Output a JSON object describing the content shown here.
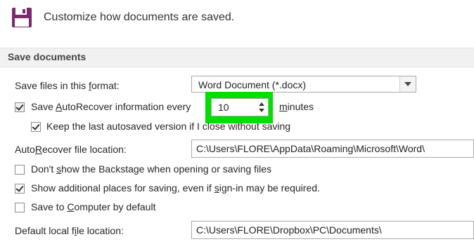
{
  "header": {
    "title": "Customize how documents are saved.",
    "icon": "floppy-disk-icon"
  },
  "section": {
    "title": "Save documents"
  },
  "format": {
    "label_pre": "Save files in this ",
    "label_key": "f",
    "label_post": "ormat:",
    "selected": "Word Document (*.docx)"
  },
  "autorecover": {
    "checked": true,
    "label_pre": "Save ",
    "label_key": "A",
    "label_post": "utoRecover information every",
    "minutes_value": "10",
    "minutes_key": "m",
    "minutes_rest": "inutes"
  },
  "keep_last": {
    "checked": true,
    "label": "Keep the last autosaved version if I close without saving"
  },
  "autorecover_location": {
    "label_pre": "Auto",
    "label_key": "R",
    "label_post": "ecover file location:",
    "value": "C:\\Users\\FLORE\\AppData\\Roaming\\Microsoft\\Word\\"
  },
  "backstage": {
    "checked": false,
    "label_pre": "Don't ",
    "label_key": "s",
    "label_post": "how the Backstage when opening or saving files"
  },
  "additional_places": {
    "checked": true,
    "label_pre": "Show additional places for saving, even if ",
    "label_key": "s",
    "label_post": "ign-in may be required."
  },
  "save_computer": {
    "checked": false,
    "label_pre": "Save to ",
    "label_key": "C",
    "label_post": "omputer by default"
  },
  "default_location": {
    "label_pre": "Default local f",
    "label_key": "i",
    "label_post": "le location:",
    "value": "C:\\Users\\FLORE\\Dropbox\\PC\\Documents\\"
  },
  "colors": {
    "highlight": "#00e000",
    "section_bg": "#f1f1f1"
  }
}
